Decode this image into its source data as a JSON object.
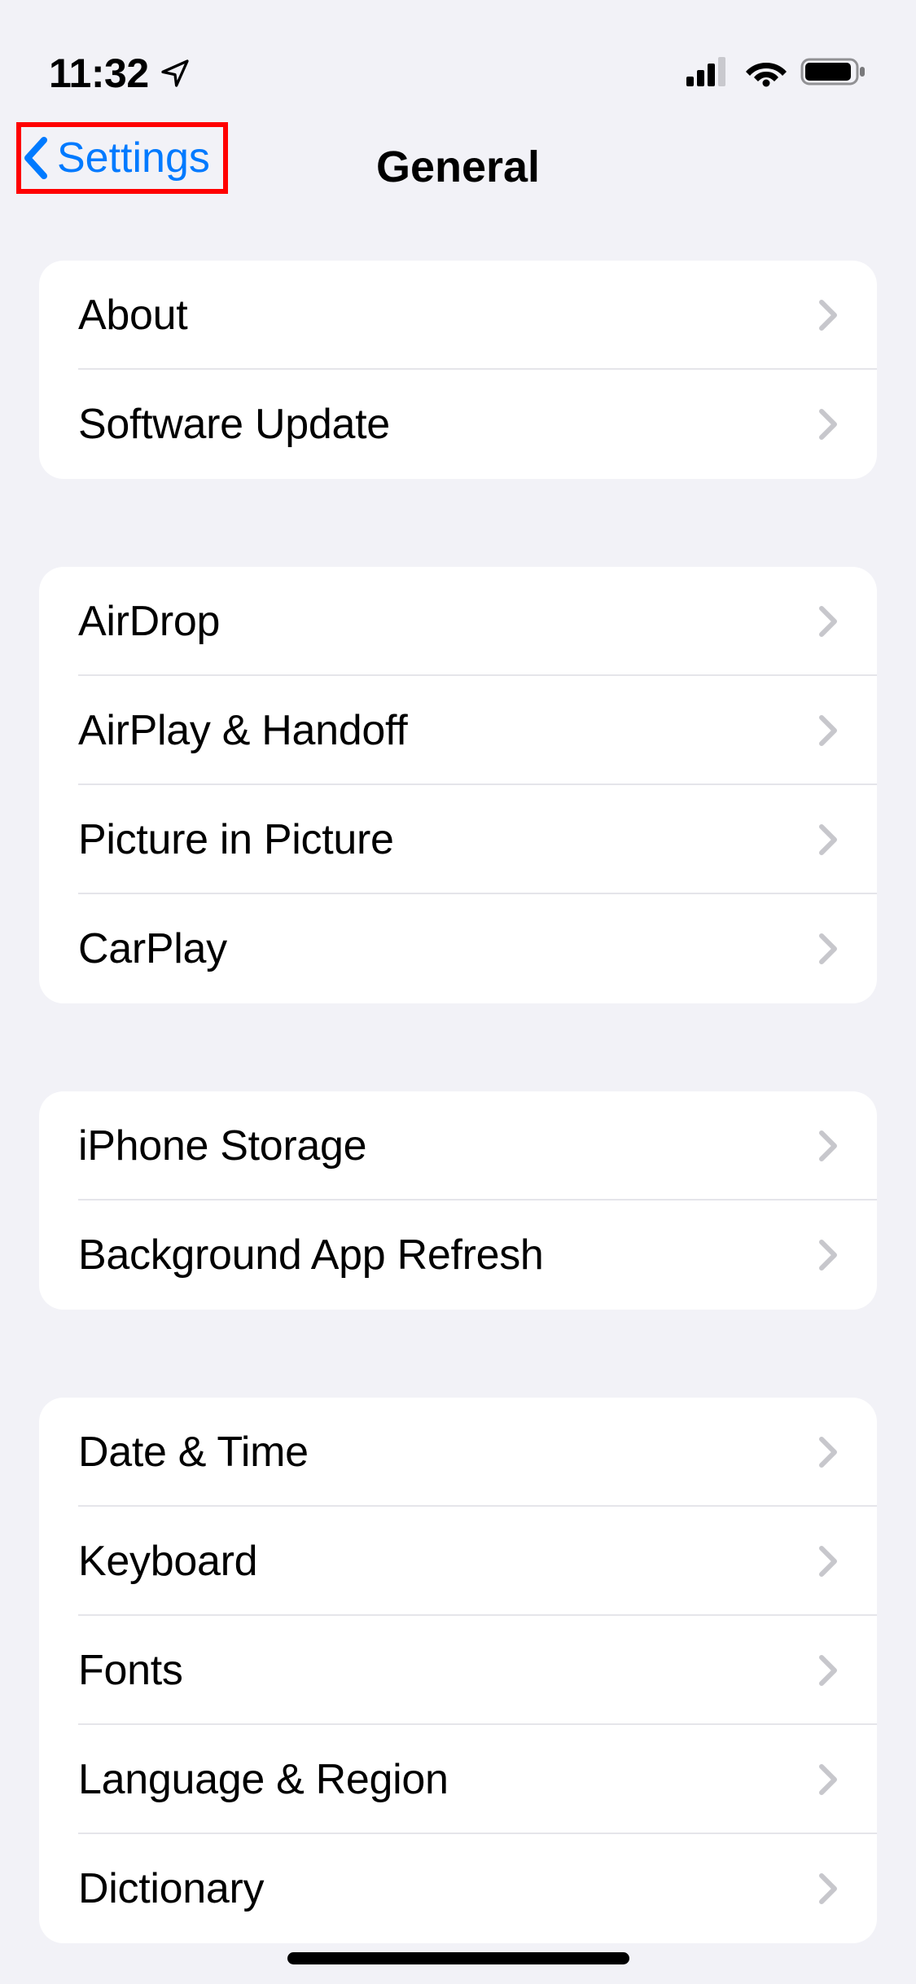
{
  "status": {
    "time": "11:32"
  },
  "nav": {
    "back_label": "Settings",
    "title": "General"
  },
  "groups": [
    {
      "rows": [
        {
          "label": "About"
        },
        {
          "label": "Software Update"
        }
      ]
    },
    {
      "rows": [
        {
          "label": "AirDrop"
        },
        {
          "label": "AirPlay & Handoff"
        },
        {
          "label": "Picture in Picture"
        },
        {
          "label": "CarPlay"
        }
      ]
    },
    {
      "rows": [
        {
          "label": "iPhone Storage"
        },
        {
          "label": "Background App Refresh"
        }
      ]
    },
    {
      "rows": [
        {
          "label": "Date & Time"
        },
        {
          "label": "Keyboard"
        },
        {
          "label": "Fonts"
        },
        {
          "label": "Language & Region"
        },
        {
          "label": "Dictionary"
        }
      ]
    }
  ]
}
